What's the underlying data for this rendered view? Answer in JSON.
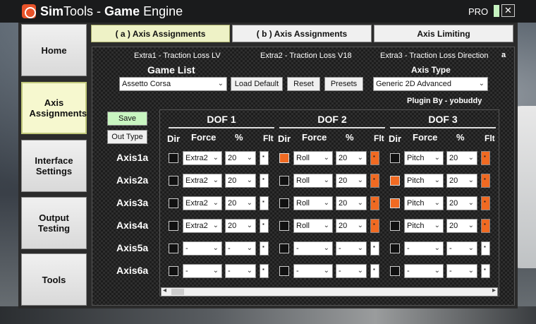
{
  "window": {
    "title_sim": "Sim",
    "title_tools": "Tools - ",
    "title_game": "Game",
    "title_engine": " Engine",
    "pro_label": "PRO",
    "close_glyph": "✕"
  },
  "sidebar": {
    "items": [
      {
        "label": "Home"
      },
      {
        "label": "Axis Assignments",
        "active": true
      },
      {
        "label": "Interface Settings"
      },
      {
        "label": "Output Testing"
      },
      {
        "label": "Tools"
      }
    ]
  },
  "tabs": [
    {
      "label": "( a ) Axis Assignments",
      "active": true
    },
    {
      "label": "( b ) Axis Assignments"
    },
    {
      "label": "Axis Limiting"
    }
  ],
  "extras": [
    "Extra1 - Traction Loss LV",
    "Extra2 - Traction Loss V18",
    "Extra3 - Traction Loss Direction"
  ],
  "corner_marker": "a",
  "game_list": {
    "heading": "Game List",
    "selected": "Assetto Corsa"
  },
  "buttons": {
    "load_default": "Load Default",
    "reset": "Reset",
    "presets": "Presets",
    "save": "Save",
    "out_type": "Out Type"
  },
  "axis_type": {
    "heading": "Axis Type",
    "selected": "Generic 2D Advanced"
  },
  "plugin_by": "Plugin By - yobuddy",
  "dof_titles": [
    "DOF 1",
    "DOF 2",
    "DOF 3"
  ],
  "col_headers": {
    "dir": "Dir",
    "force": "Force",
    "pct": "%",
    "flt": "Flt"
  },
  "axes": [
    {
      "label": "Axis1a",
      "dof": [
        {
          "dir": false,
          "force": "Extra2",
          "pct": "20",
          "flt": false
        },
        {
          "dir": true,
          "force": "Roll",
          "pct": "20",
          "flt": true
        },
        {
          "dir": false,
          "force": "Pitch",
          "pct": "20",
          "flt": true
        }
      ]
    },
    {
      "label": "Axis2a",
      "dof": [
        {
          "dir": false,
          "force": "Extra2",
          "pct": "20",
          "flt": false
        },
        {
          "dir": false,
          "force": "Roll",
          "pct": "20",
          "flt": true
        },
        {
          "dir": true,
          "force": "Pitch",
          "pct": "20",
          "flt": true
        }
      ]
    },
    {
      "label": "Axis3a",
      "dof": [
        {
          "dir": false,
          "force": "Extra2",
          "pct": "20",
          "flt": false
        },
        {
          "dir": false,
          "force": "Roll",
          "pct": "20",
          "flt": true
        },
        {
          "dir": true,
          "force": "Pitch",
          "pct": "20",
          "flt": true
        }
      ]
    },
    {
      "label": "Axis4a",
      "dof": [
        {
          "dir": false,
          "force": "Extra2",
          "pct": "20",
          "flt": false
        },
        {
          "dir": false,
          "force": "Roll",
          "pct": "20",
          "flt": true
        },
        {
          "dir": false,
          "force": "Pitch",
          "pct": "20",
          "flt": true
        }
      ]
    },
    {
      "label": "Axis5a",
      "dof": [
        {
          "dir": false,
          "force": "-",
          "pct": "-",
          "flt": false
        },
        {
          "dir": false,
          "force": "-",
          "pct": "-",
          "flt": false
        },
        {
          "dir": false,
          "force": "-",
          "pct": "-",
          "flt": false
        }
      ]
    },
    {
      "label": "Axis6a",
      "dof": [
        {
          "dir": false,
          "force": "-",
          "pct": "-",
          "flt": false
        },
        {
          "dir": false,
          "force": "-",
          "pct": "-",
          "flt": false
        },
        {
          "dir": false,
          "force": "-",
          "pct": "-",
          "flt": false
        }
      ]
    }
  ],
  "icons": {
    "app": "simtools-logo-icon",
    "dropdown": "chevron-down-icon",
    "scroll_left": "chevron-left-icon",
    "scroll_right": "chevron-right-icon"
  },
  "colors": {
    "active_orange": "#f06a22",
    "save_green": "#c8f5c0",
    "active_tab": "#eef2c6"
  }
}
